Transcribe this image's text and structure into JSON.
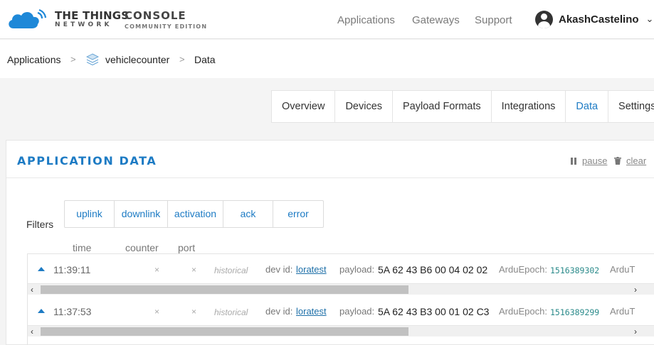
{
  "header": {
    "logo_line1": "THE THINGS",
    "logo_line2": "NETWORK",
    "product": "CONSOLE",
    "edition": "COMMUNITY EDITION",
    "nav": [
      "Applications",
      "Gateways",
      "Support"
    ],
    "username": "AkashCastelino",
    "user_menu_icon": "chevron-down-icon"
  },
  "breadcrumb": {
    "items": [
      "Applications",
      "vehiclecounter",
      "Data"
    ],
    "separator": ">",
    "app_icon": "layers-icon"
  },
  "tabs": {
    "items": [
      "Overview",
      "Devices",
      "Payload Formats",
      "Integrations",
      "Data",
      "Settings"
    ],
    "active": "Data"
  },
  "panel": {
    "title": "APPLICATION DATA",
    "pause_label": "pause",
    "clear_label": "clear",
    "filters_label": "Filters",
    "filters": [
      "uplink",
      "downlink",
      "activation",
      "ack",
      "error"
    ],
    "columns": [
      "time",
      "counter",
      "port"
    ]
  },
  "events": [
    {
      "time": "11:39:11",
      "counter": "×",
      "port": "×",
      "status": "historical",
      "dev_id_label": "dev id:",
      "dev_id": "loratest",
      "payload_label": "payload:",
      "payload": "5A 62 43 B6 00 04 02 02",
      "field_label": "ArduEpoch:",
      "field_value": "1516389302",
      "more": "ArduT"
    },
    {
      "time": "11:37:53",
      "counter": "×",
      "port": "×",
      "status": "historical",
      "dev_id_label": "dev id:",
      "dev_id": "loratest",
      "payload_label": "payload:",
      "payload": "5A 62 43 B3 00 01 02 C3",
      "field_label": "ArduEpoch:",
      "field_value": "1516389299",
      "more": "ArduT"
    }
  ],
  "colors": {
    "accent": "#1d7bc4",
    "logo_blue": "#1e88d8",
    "value_teal": "#2a8a8a"
  }
}
